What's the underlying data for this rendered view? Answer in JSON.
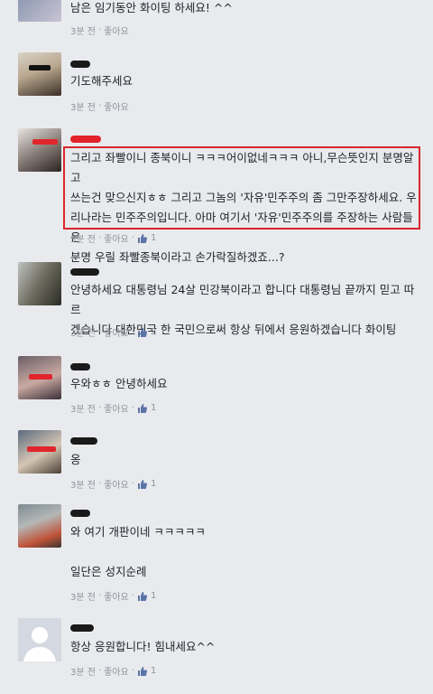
{
  "comments": [
    {
      "text": "남은 임기동안 화이팅 하세요! ^^",
      "time": "3분 전",
      "like_label": "좋아요",
      "likes": ""
    },
    {
      "text": "기도해주세요",
      "time": "3분 전",
      "like_label": "좋아요",
      "likes": ""
    },
    {
      "text_lines": [
        "그리고 좌빨이니 종북이니 ㅋㅋㅋ어이없네ㅋㅋㅋ 아니,무슨뜻인지 분명알고",
        "쓰는건 맞으신지ㅎㅎ 그리고 그놈의 '자유'민주주의 좀 그만주장하세요. 우",
        "리나라는 민주주의입니다. 아마 여기서 '자유'민주주의를 주장하는 사람들은",
        "분명 우릴 좌빨종북이라고 손가락질하겠죠...?"
      ],
      "time": "3분 전",
      "like_label": "좋아요",
      "likes": "1"
    },
    {
      "text_lines": [
        "안녕하세요 대통령님 24살 민강북이라고 합니다 대통령님 끝까지 믿고 따르",
        "겠습니다 대한민국 한 국민으로써 항상 뒤에서 응원하겠습니다 화이팅"
      ],
      "time": "3분 전",
      "like_label": "좋아요",
      "likes": "2"
    },
    {
      "text": "우와ㅎㅎ 안녕하세요",
      "time": "3분 전",
      "like_label": "좋아요",
      "likes": "1"
    },
    {
      "text": "옹",
      "time": "3분 전",
      "like_label": "좋아요",
      "likes": "1"
    },
    {
      "text_lines": [
        "와 여기 개판이네 ㅋㅋㅋㅋㅋ",
        "",
        "일단은 성지순례"
      ],
      "time": "3분 전",
      "like_label": "좋아요",
      "likes": "1"
    },
    {
      "text": "항상 응원합니다! 힘내세요^^",
      "time": "3분 전",
      "like_label": "좋아요",
      "likes": "1"
    }
  ],
  "separator": "·",
  "icons": {
    "like": "thumbs-up-icon"
  },
  "colors": {
    "highlight": "#d8262b",
    "meta": "#90949c",
    "like_icon": "#5b74a8"
  }
}
